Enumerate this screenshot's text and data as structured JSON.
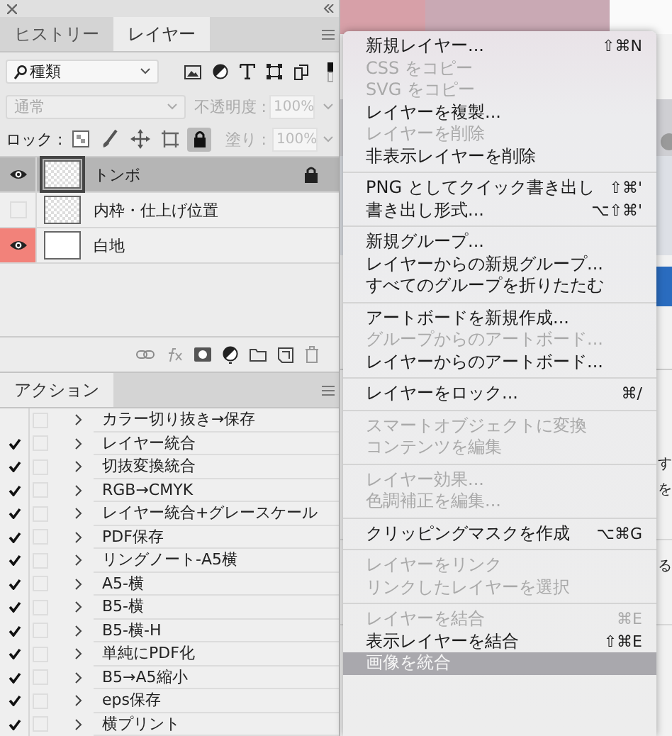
{
  "tabs": [
    {
      "label": "ヒストリー",
      "selected": false
    },
    {
      "label": "レイヤー",
      "selected": true
    }
  ],
  "filter": {
    "value": "種類"
  },
  "blend_mode": {
    "value": "通常",
    "disabled": true
  },
  "opacity": {
    "label": "不透明度 :",
    "value": "100%",
    "disabled": true
  },
  "lock": {
    "label": "ロック :",
    "buttons": [
      {
        "kind": "pixels",
        "selected": false
      },
      {
        "kind": "paint",
        "selected": false
      },
      {
        "kind": "move",
        "selected": false
      },
      {
        "kind": "artboard",
        "selected": false
      },
      {
        "kind": "all",
        "selected": true
      }
    ]
  },
  "fill": {
    "label": "塗り :",
    "value": "100%",
    "disabled": true
  },
  "layers": [
    {
      "name": "トンボ",
      "visible": true,
      "selected": true,
      "locked": true,
      "transparent": true
    },
    {
      "name": "内枠・仕上げ位置",
      "visible": false,
      "selected": false,
      "locked": false,
      "transparent": true
    },
    {
      "name": "白地",
      "visible": true,
      "selected": false,
      "locked": false,
      "transparent": false,
      "color": "#f2827a"
    }
  ],
  "actions_tab": {
    "label": "アクション"
  },
  "actions": [
    {
      "name": "カラー切り抜き→保存",
      "checked": false
    },
    {
      "name": "レイヤー統合",
      "checked": true
    },
    {
      "name": "切抜変換統合",
      "checked": true
    },
    {
      "name": "RGB→CMYK",
      "checked": true
    },
    {
      "name": "レイヤー統合+グレースケール",
      "checked": true
    },
    {
      "name": "PDF保存",
      "checked": true
    },
    {
      "name": "リングノート-A5横",
      "checked": true
    },
    {
      "name": "A5-横",
      "checked": true
    },
    {
      "name": "B5-横",
      "checked": true
    },
    {
      "name": "B5-横-H",
      "checked": true
    },
    {
      "name": "単純にPDF化",
      "checked": true
    },
    {
      "name": "B5→A5縮小",
      "checked": true
    },
    {
      "name": "eps保存",
      "checked": true
    },
    {
      "name": "横プリント",
      "checked": true
    }
  ],
  "menu": {
    "items": [
      {
        "kind": "item",
        "label": "新規レイヤー...",
        "shortcut": "⇧⌘N",
        "disabled": false,
        "selected": false
      },
      {
        "kind": "item",
        "label": "CSS をコピー",
        "disabled": true,
        "selected": false
      },
      {
        "kind": "item",
        "label": "SVG をコピー",
        "disabled": true,
        "selected": false
      },
      {
        "kind": "item",
        "label": "レイヤーを複製...",
        "disabled": false,
        "selected": false
      },
      {
        "kind": "item",
        "label": "レイヤーを削除",
        "disabled": true,
        "selected": false
      },
      {
        "kind": "item",
        "label": "非表示レイヤーを削除",
        "disabled": false,
        "selected": false
      },
      {
        "kind": "separator"
      },
      {
        "kind": "item",
        "label": "PNG としてクイック書き出し",
        "shortcut": "⇧⌘'",
        "disabled": false,
        "selected": false
      },
      {
        "kind": "item",
        "label": "書き出し形式...",
        "shortcut": "⌥⇧⌘'",
        "disabled": false,
        "selected": false
      },
      {
        "kind": "separator"
      },
      {
        "kind": "item",
        "label": "新規グループ...",
        "disabled": false,
        "selected": false
      },
      {
        "kind": "item",
        "label": "レイヤーからの新規グループ...",
        "disabled": false,
        "selected": false
      },
      {
        "kind": "item",
        "label": "すべてのグループを折りたたむ",
        "disabled": false,
        "selected": false
      },
      {
        "kind": "separator"
      },
      {
        "kind": "item",
        "label": "アートボードを新規作成...",
        "disabled": false,
        "selected": false
      },
      {
        "kind": "item",
        "label": "グループからのアートボード...",
        "disabled": true,
        "selected": false
      },
      {
        "kind": "item",
        "label": "レイヤーからのアートボード...",
        "disabled": false,
        "selected": false
      },
      {
        "kind": "separator"
      },
      {
        "kind": "item",
        "label": "レイヤーをロック...",
        "shortcut": "⌘/",
        "disabled": false,
        "selected": false
      },
      {
        "kind": "separator"
      },
      {
        "kind": "item",
        "label": "スマートオブジェクトに変換",
        "disabled": true,
        "selected": false
      },
      {
        "kind": "item",
        "label": "コンテンツを編集",
        "disabled": true,
        "selected": false
      },
      {
        "kind": "separator"
      },
      {
        "kind": "item",
        "label": "レイヤー効果...",
        "disabled": true,
        "selected": false
      },
      {
        "kind": "item",
        "label": "色調補正を編集...",
        "disabled": true,
        "selected": false
      },
      {
        "kind": "separator"
      },
      {
        "kind": "item",
        "label": "クリッピングマスクを作成",
        "shortcut": "⌥⌘G",
        "disabled": false,
        "selected": false
      },
      {
        "kind": "separator"
      },
      {
        "kind": "item",
        "label": "レイヤーをリンク",
        "disabled": true,
        "selected": false
      },
      {
        "kind": "item",
        "label": "リンクしたレイヤーを選択",
        "disabled": true,
        "selected": false
      },
      {
        "kind": "separator"
      },
      {
        "kind": "item",
        "label": "レイヤーを結合",
        "shortcut": "⌘E",
        "disabled": true,
        "selected": false
      },
      {
        "kind": "item",
        "label": "表示レイヤーを結合",
        "shortcut": "⇧⌘E",
        "disabled": false,
        "selected": false
      },
      {
        "kind": "item",
        "label": "画像を統合",
        "disabled": false,
        "selected": true
      }
    ]
  },
  "background_text": [
    "す",
    "を",
    "る"
  ]
}
